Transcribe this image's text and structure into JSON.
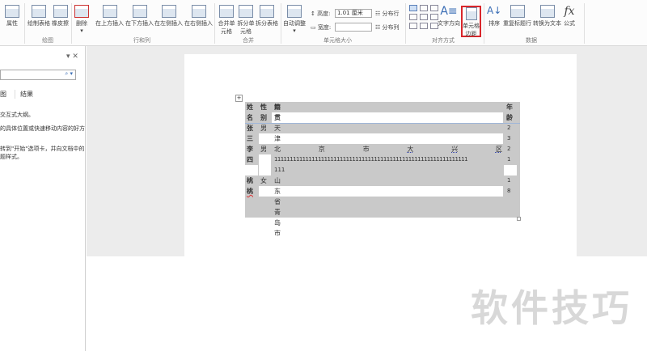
{
  "ribbon": {
    "buttons": [
      "属性",
      "绘制表格",
      "橡皮擦",
      "删除",
      "在上方插入",
      "在下方插入",
      "在左侧插入",
      "在右侧插入",
      "合并单元格",
      "拆分单元格",
      "拆分表格",
      "自动调整",
      "文字方向",
      "单元格边距",
      "排序",
      "重复标题行",
      "转换为文本",
      "公式"
    ],
    "groups": [
      "绘图",
      "行和列",
      "合并",
      "单元格大小",
      "对齐方式",
      "数据"
    ],
    "height_label": "高度:",
    "height_value": "1.01 厘米",
    "width_label": "宽度:",
    "width_value": "",
    "distribute_rows": "分布行",
    "distribute_cols": "分布列",
    "highlight_color": "#d9262b"
  },
  "left_panel": {
    "search_placeholder": "",
    "tabs": [
      "图",
      "结果"
    ],
    "lines": [
      "交互式大纲。",
      "的具体位置或快速移动内容的好方",
      "转到\"开始\"选项卡，并向文档中的",
      "题样式。"
    ]
  },
  "table": {
    "header": {
      "name": [
        "姓",
        "名"
      ],
      "sex": [
        "性",
        "别"
      ],
      "origin": "籍贯",
      "age": [
        "年",
        "龄"
      ]
    },
    "rows": [
      {
        "name": [
          "张",
          "三"
        ],
        "sex": "男",
        "origin": "天津",
        "age": [
          "2",
          "3"
        ]
      },
      {
        "name": [
          "李",
          "四"
        ],
        "sex": "男",
        "origin_chars": [
          "北",
          "京",
          "市",
          "大",
          "兴",
          "区"
        ],
        "origin_line2": "11111111111111111111111111111111111111111111111111111111111111",
        "origin_line3": "111",
        "age": [
          "2",
          "1"
        ]
      },
      {
        "name": [
          "桃",
          "桃"
        ],
        "sex": "女",
        "origin": "山东省青岛市",
        "age": [
          "1",
          "8"
        ]
      }
    ]
  },
  "watermark": "软件技巧"
}
